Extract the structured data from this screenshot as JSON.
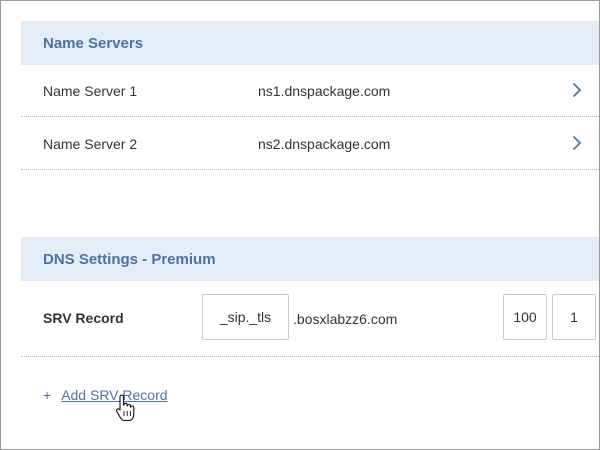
{
  "name_servers": {
    "title": "Name Servers",
    "rows": [
      {
        "label": "Name Server 1",
        "value": "ns1.dnspackage.com"
      },
      {
        "label": "Name Server 2",
        "value": "ns2.dnspackage.com"
      }
    ]
  },
  "dns_settings": {
    "title": "DNS Settings - Premium",
    "srv": {
      "label": "SRV Record",
      "service_value": "_sip._tls",
      "domain_suffix": ".bosxlabzz6.com",
      "priority_value": "100",
      "weight_value": "1"
    },
    "add_plus": "+",
    "add_label": "Add SRV Record"
  },
  "colors": {
    "header_bg": "#e3ecf7",
    "header_text": "#4f73a0",
    "link": "#4f73a0"
  },
  "icons": {
    "row_chevron": "chevron-right-icon",
    "pointer": "hand-pointer-icon"
  }
}
